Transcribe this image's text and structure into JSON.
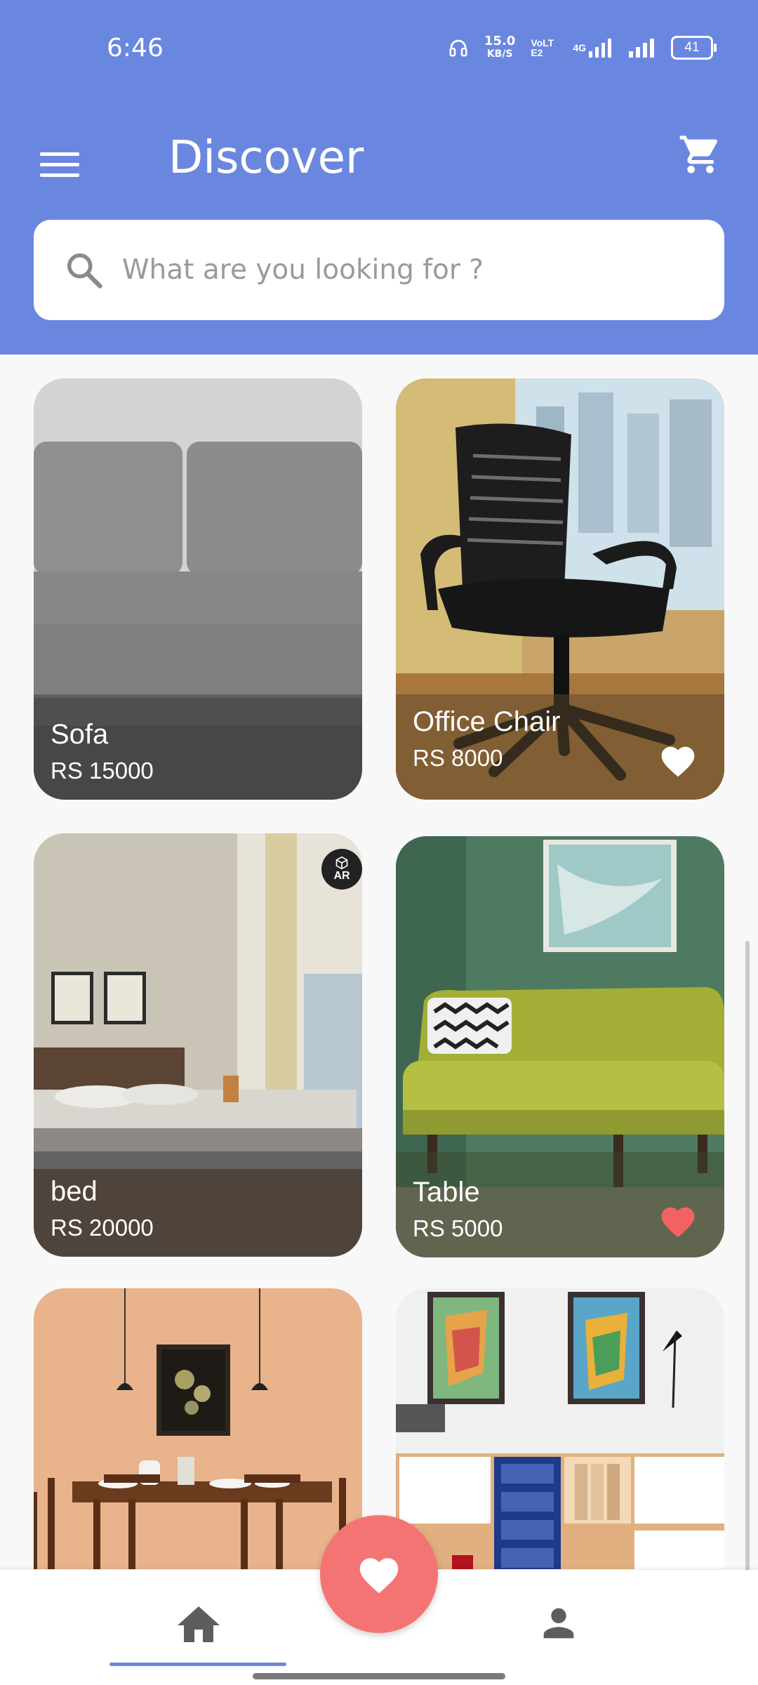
{
  "status_bar": {
    "time": "6:46",
    "speed_value": "15.0",
    "speed_unit": "KB/S",
    "volte": "VoLTE2",
    "network": "4G",
    "battery": "41"
  },
  "header": {
    "title": "Discover"
  },
  "search": {
    "placeholder": "What are you looking for ?"
  },
  "products": [
    {
      "name": "Sofa",
      "price": "RS 15000",
      "favorite": false
    },
    {
      "name": "Office Chair",
      "price": "RS 8000",
      "favorite": true,
      "heart_color": "#ffffff"
    },
    {
      "name": "bed",
      "price": "RS 20000",
      "favorite": false,
      "badge": "AR"
    },
    {
      "name": "Table",
      "price": "RS 5000",
      "favorite": true,
      "heart_color": "#f26262"
    },
    {
      "name": "",
      "price": ""
    },
    {
      "name": "",
      "price": ""
    }
  ],
  "colors": {
    "primary": "#6a87e0",
    "fab": "#f47474",
    "heart_red": "#f26262"
  },
  "bottom_nav": {
    "items": [
      "home-icon",
      "favorite-icon",
      "profile-icon"
    ],
    "active": "home-icon"
  }
}
